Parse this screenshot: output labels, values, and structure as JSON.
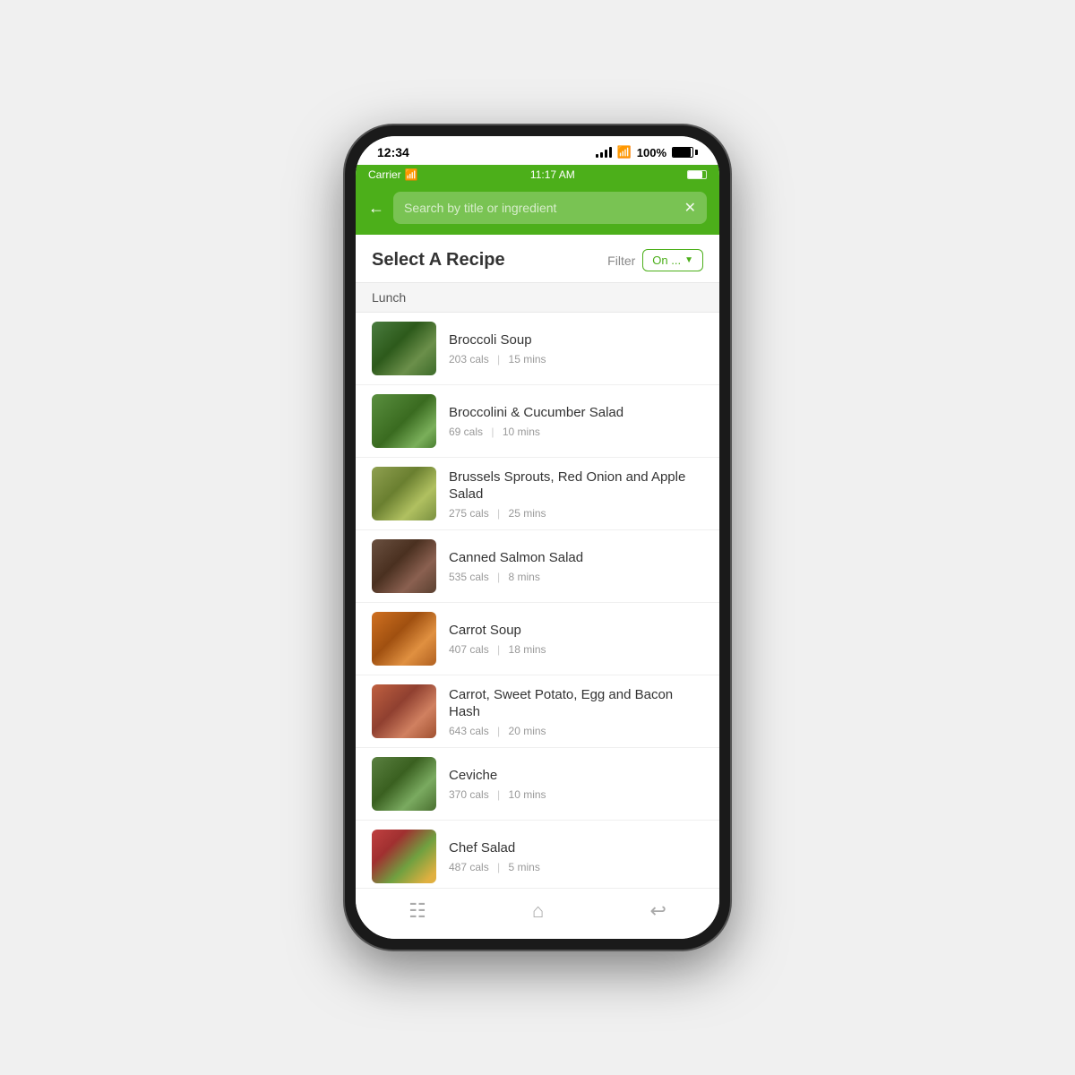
{
  "phone": {
    "system_time": "12:34",
    "carrier_time": "11:17 AM",
    "carrier_name": "Carrier",
    "battery_pct": "100%"
  },
  "app": {
    "search_placeholder": "Search by title or ingredient",
    "page_title": "Select A Recipe",
    "filter_label": "Filter",
    "filter_value": "On ...",
    "category": "Lunch"
  },
  "recipes": [
    {
      "id": 1,
      "name": "Broccoli Soup",
      "cals": "203 cals",
      "mins": "15 mins",
      "img_class": "food-broccoli-soup"
    },
    {
      "id": 2,
      "name": "Broccolini & Cucumber Salad",
      "cals": "69 cals",
      "mins": "10 mins",
      "img_class": "food-broccolini-salad"
    },
    {
      "id": 3,
      "name": "Brussels Sprouts, Red Onion and Apple Salad",
      "cals": "275 cals",
      "mins": "25 mins",
      "img_class": "food-brussels-sprouts"
    },
    {
      "id": 4,
      "name": "Canned Salmon Salad",
      "cals": "535 cals",
      "mins": "8 mins",
      "img_class": "food-canned-salmon"
    },
    {
      "id": 5,
      "name": "Carrot Soup",
      "cals": "407 cals",
      "mins": "18 mins",
      "img_class": "food-carrot-soup"
    },
    {
      "id": 6,
      "name": "Carrot, Sweet Potato, Egg and Bacon Hash",
      "cals": "643 cals",
      "mins": "20 mins",
      "img_class": "food-carrot-hash"
    },
    {
      "id": 7,
      "name": "Ceviche",
      "cals": "370 cals",
      "mins": "10 mins",
      "img_class": "food-ceviche"
    },
    {
      "id": 8,
      "name": "Chef Salad",
      "cals": "487 cals",
      "mins": "5 mins",
      "img_class": "food-chef-salad"
    }
  ],
  "nav": {
    "menu_icon": "☰",
    "home_icon": "⌂",
    "back_icon": "↩"
  }
}
